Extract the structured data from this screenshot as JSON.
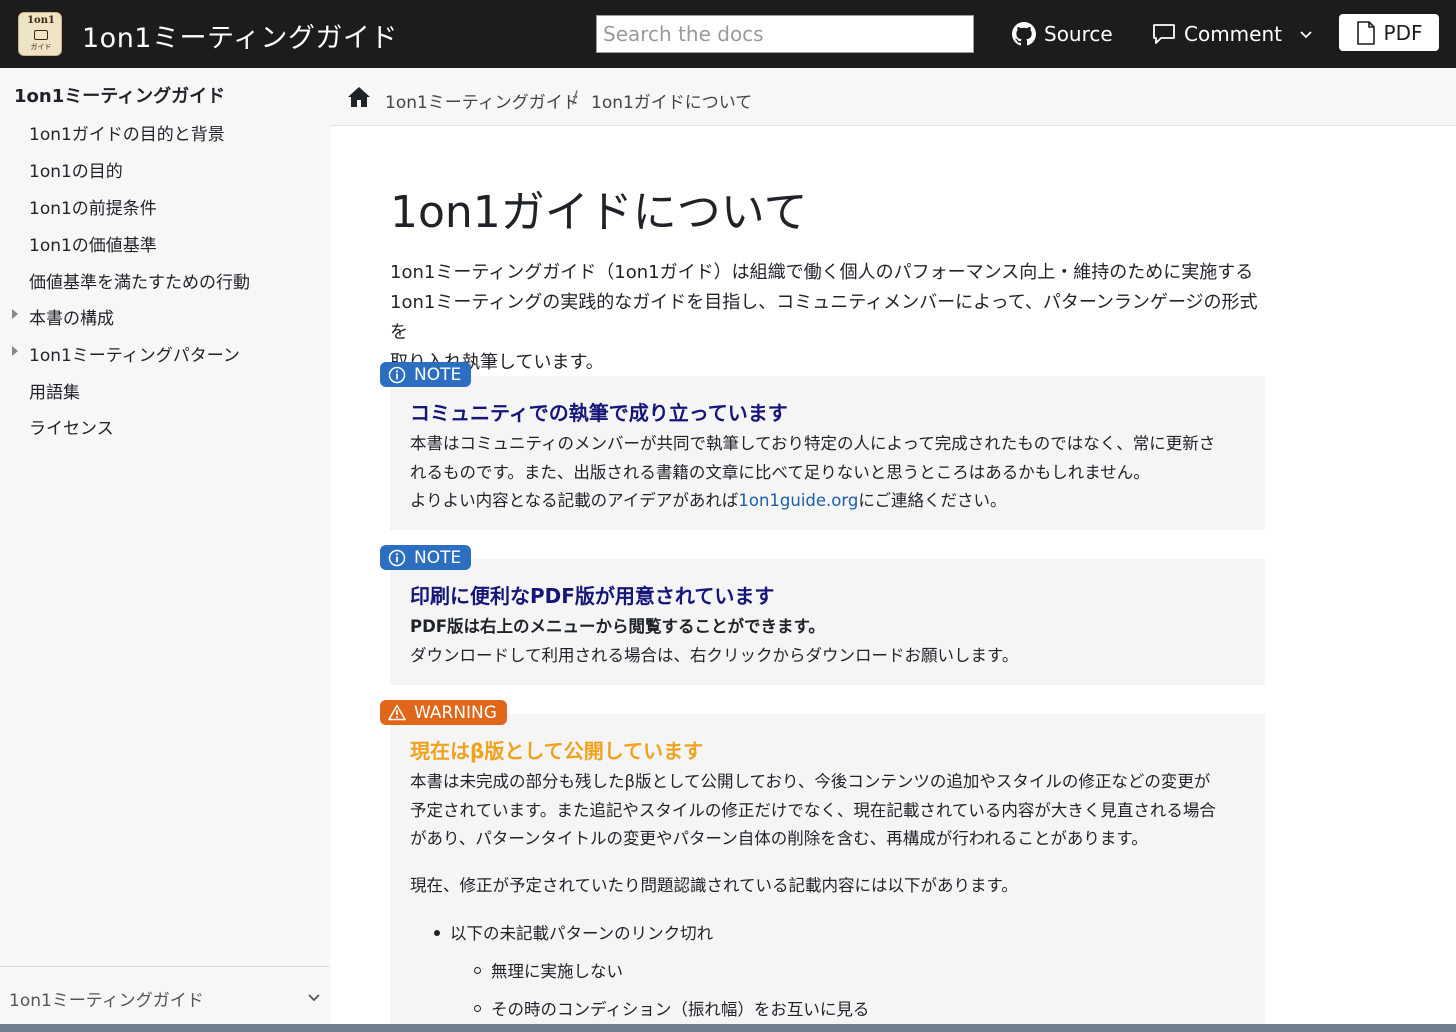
{
  "header": {
    "logo_top": "1on1",
    "logo_bottom": "ガイド",
    "site_title": "1on1ミーティングガイド",
    "search_placeholder": "Search the docs",
    "source_label": "Source",
    "comment_label": "Comment",
    "pdf_label": "PDF"
  },
  "sidebar": {
    "heading": "1on1ミーティングガイド",
    "items": [
      {
        "label": "1on1ガイドの目的と背景"
      },
      {
        "label": "1on1の目的"
      },
      {
        "label": "1on1の前提条件"
      },
      {
        "label": "1on1の価値基準"
      },
      {
        "label": "価値基準を満たすための行動"
      },
      {
        "label": "本書の構成"
      },
      {
        "label": "1on1ミーティングパターン"
      },
      {
        "label": "用語集"
      },
      {
        "label": "ライセンス"
      }
    ],
    "footer_label": "1on1ミーティングガイド"
  },
  "breadcrumb": {
    "items": [
      "1on1ミーティングガイド",
      "1on1ガイドについて"
    ],
    "separator": "/"
  },
  "main": {
    "title": "1on1ガイドについて",
    "intro_lines": [
      "1on1ミーティングガイド（1on1ガイド）は組織で働く個人のパフォーマンス向上・維持のために実施する",
      "1on1ミーティングの実践的なガイドを目指し、コミュニティメンバーによって、パターンランゲージの形式を",
      "取り入れ執筆しています。"
    ],
    "note1": {
      "badge": "NOTE",
      "title": "コミュニティでの執筆で成り立っています",
      "lines": [
        "本書はコミュニティのメンバーが共同で執筆しており特定の人によって完成されたものではなく、常に更新さ",
        "れるものです。また、出版される書籍の文章に比べて足りないと思うところはあるかもしれません。"
      ],
      "line3_pre": "よりよい内容となる記載のアイデアがあれば",
      "link": "1on1guide.org",
      "line3_post": "にご連絡ください。"
    },
    "note2": {
      "badge": "NOTE",
      "title": "印刷に便利なPDF版が用意されています",
      "strong_line": "PDF版は右上のメニューから閲覧することができます。",
      "line2": "ダウンロードして利用される場合は、右クリックからダウンロードお願いします。"
    },
    "warning": {
      "badge": "WARNING",
      "title": "現在はβ版として公開しています",
      "lines": [
        "本書は未完成の部分も残したβ版として公開しており、今後コンテンツの追加やスタイルの修正などの変更が",
        "予定されています。また追記やスタイルの修正だけでなく、現在記載されている内容が大きく見直される場合",
        "があり、パターンタイトルの変更やパターン自体の削除を含む、再構成が行われることがあります。"
      ],
      "para2": "現在、修正が予定されていたり問題認識されている記載内容には以下があります。",
      "bullet": "以下の未記載パターンのリンク切れ",
      "sub_bullets": [
        "無理に実施しない",
        "その時のコンディション（振れ幅）をお互いに見る"
      ]
    }
  },
  "colors": {
    "topbar": "#1c1c1c",
    "note_badge": "#2c6fc0",
    "warning_badge": "#e0661a",
    "note_title": "#15157a",
    "warning_title": "#f0a21e",
    "link": "#1a5fa8"
  },
  "icons": [
    "github-icon",
    "comment-icon",
    "chevron-down-icon",
    "pdf-file-icon",
    "home-icon",
    "info-icon",
    "warning-triangle-icon"
  ]
}
